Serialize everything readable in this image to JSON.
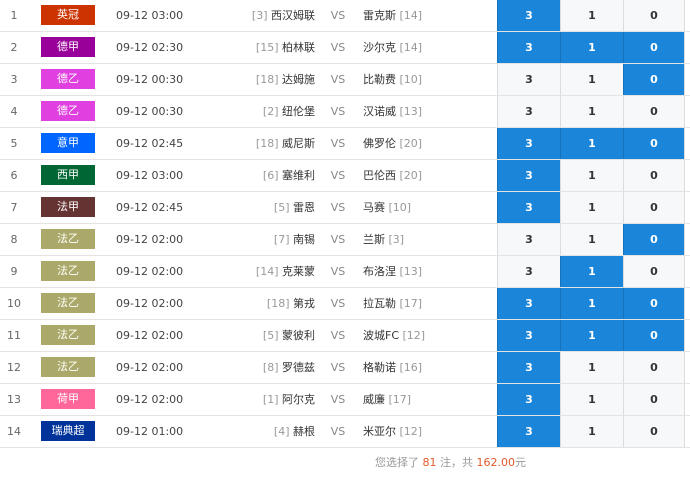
{
  "matches": [
    {
      "index": "1",
      "league": "英冠",
      "league_color": "#cc3300",
      "time": "09-12 03:00",
      "home_rank": "[3]",
      "home": "西汉姆联",
      "vs": "VS",
      "away": "雷克斯",
      "away_rank": "[14]",
      "odds": [
        "3",
        "1",
        "0"
      ],
      "selected": [
        true,
        false,
        false
      ]
    },
    {
      "index": "2",
      "league": "德甲",
      "league_color": "#990099",
      "time": "09-12 02:30",
      "home_rank": "[15]",
      "home": "柏林联",
      "vs": "VS",
      "away": "沙尔克",
      "away_rank": "[14]",
      "odds": [
        "3",
        "1",
        "0"
      ],
      "selected": [
        true,
        true,
        true
      ]
    },
    {
      "index": "3",
      "league": "德乙",
      "league_color": "#e040e0",
      "time": "09-12 00:30",
      "home_rank": "[18]",
      "home": "达姆施",
      "vs": "VS",
      "away": "比勒费",
      "away_rank": "[10]",
      "odds": [
        "3",
        "1",
        "0"
      ],
      "selected": [
        false,
        false,
        true
      ]
    },
    {
      "index": "4",
      "league": "德乙",
      "league_color": "#e040e0",
      "time": "09-12 00:30",
      "home_rank": "[2]",
      "home": "纽伦堡",
      "vs": "VS",
      "away": "汉诺威",
      "away_rank": "[13]",
      "odds": [
        "3",
        "1",
        "0"
      ],
      "selected": [
        false,
        false,
        false
      ]
    },
    {
      "index": "5",
      "league": "意甲",
      "league_color": "#0066ff",
      "time": "09-12 02:45",
      "home_rank": "[18]",
      "home": "威尼斯",
      "vs": "VS",
      "away": "佛罗伦",
      "away_rank": "[20]",
      "odds": [
        "3",
        "1",
        "0"
      ],
      "selected": [
        true,
        true,
        true
      ]
    },
    {
      "index": "6",
      "league": "西甲",
      "league_color": "#006633",
      "time": "09-12 03:00",
      "home_rank": "[6]",
      "home": "塞维利",
      "vs": "VS",
      "away": "巴伦西",
      "away_rank": "[20]",
      "odds": [
        "3",
        "1",
        "0"
      ],
      "selected": [
        true,
        false,
        false
      ]
    },
    {
      "index": "7",
      "league": "法甲",
      "league_color": "#663333",
      "time": "09-12 02:45",
      "home_rank": "[5]",
      "home": "雷恩",
      "vs": "VS",
      "away": "马赛",
      "away_rank": "[10]",
      "odds": [
        "3",
        "1",
        "0"
      ],
      "selected": [
        true,
        false,
        false
      ]
    },
    {
      "index": "8",
      "league": "法乙",
      "league_color": "#aaa96a",
      "time": "09-12 02:00",
      "home_rank": "[7]",
      "home": "南锡",
      "vs": "VS",
      "away": "兰斯",
      "away_rank": "[3]",
      "odds": [
        "3",
        "1",
        "0"
      ],
      "selected": [
        false,
        false,
        true
      ]
    },
    {
      "index": "9",
      "league": "法乙",
      "league_color": "#aaa96a",
      "time": "09-12 02:00",
      "home_rank": "[14]",
      "home": "克莱蒙",
      "vs": "VS",
      "away": "布洛涅",
      "away_rank": "[13]",
      "odds": [
        "3",
        "1",
        "0"
      ],
      "selected": [
        false,
        true,
        false
      ]
    },
    {
      "index": "10",
      "league": "法乙",
      "league_color": "#aaa96a",
      "time": "09-12 02:00",
      "home_rank": "[18]",
      "home": "第戎",
      "vs": "VS",
      "away": "拉瓦勒",
      "away_rank": "[17]",
      "odds": [
        "3",
        "1",
        "0"
      ],
      "selected": [
        true,
        true,
        true
      ]
    },
    {
      "index": "11",
      "league": "法乙",
      "league_color": "#aaa96a",
      "time": "09-12 02:00",
      "home_rank": "[5]",
      "home": "蒙彼利",
      "vs": "VS",
      "away": "波城FC",
      "away_rank": "[12]",
      "odds": [
        "3",
        "1",
        "0"
      ],
      "selected": [
        true,
        true,
        true
      ]
    },
    {
      "index": "12",
      "league": "法乙",
      "league_color": "#aaa96a",
      "time": "09-12 02:00",
      "home_rank": "[8]",
      "home": "罗德兹",
      "vs": "VS",
      "away": "格勒诺",
      "away_rank": "[16]",
      "odds": [
        "3",
        "1",
        "0"
      ],
      "selected": [
        true,
        false,
        false
      ]
    },
    {
      "index": "13",
      "league": "荷甲",
      "league_color": "#ff6699",
      "time": "09-12 02:00",
      "home_rank": "[1]",
      "home": "阿尔克",
      "vs": "VS",
      "away": "威廉",
      "away_rank": "[17]",
      "odds": [
        "3",
        "1",
        "0"
      ],
      "selected": [
        true,
        false,
        false
      ]
    },
    {
      "index": "14",
      "league": "瑞典超",
      "league_color": "#003399",
      "time": "09-12 01:00",
      "home_rank": "[4]",
      "home": "赫根",
      "vs": "VS",
      "away": "米亚尔",
      "away_rank": "[12]",
      "odds": [
        "3",
        "1",
        "0"
      ],
      "selected": [
        true,
        false,
        false
      ]
    }
  ],
  "summary": {
    "prefix": "您选择了",
    "count": "81",
    "middle": "注，共",
    "amount": "162.00",
    "suffix": "元"
  }
}
